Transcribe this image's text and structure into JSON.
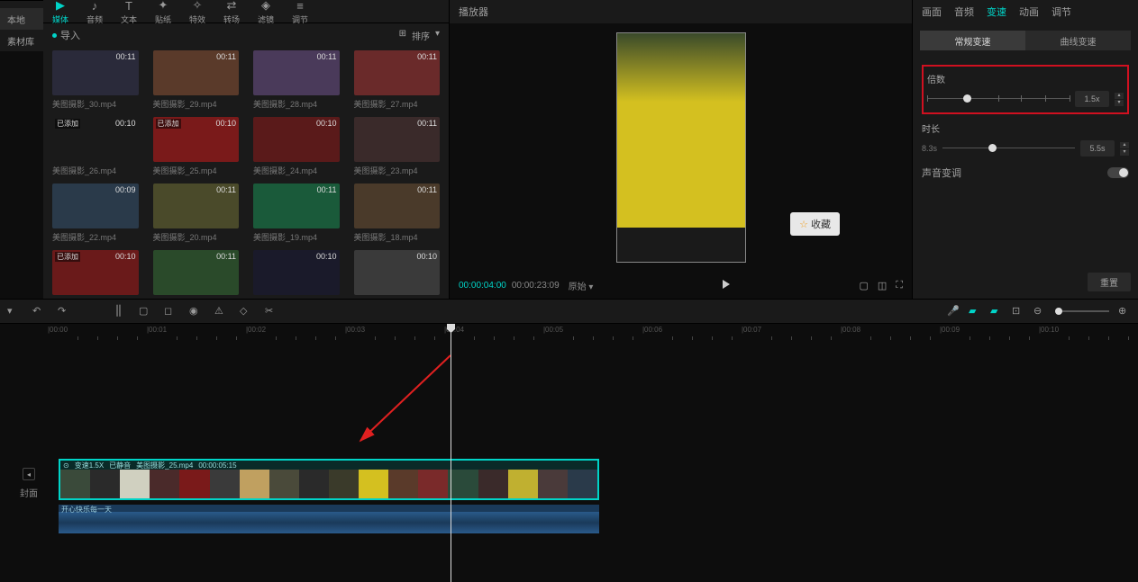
{
  "nav": {
    "tabs": [
      "媒体",
      "音频",
      "文本",
      "贴纸",
      "特效",
      "转场",
      "滤镜",
      "调节"
    ]
  },
  "sidebar": {
    "items": [
      "本地",
      "素材库"
    ]
  },
  "media": {
    "import": "导入",
    "sort": "排序",
    "items": [
      {
        "d": "00:11",
        "n": "美图摄影_30.mp4",
        "c": "#2a2a3a"
      },
      {
        "d": "00:11",
        "n": "美图摄影_29.mp4",
        "c": "#5a3a2a"
      },
      {
        "d": "00:11",
        "n": "美图摄影_28.mp4",
        "c": "#4a3a5a"
      },
      {
        "d": "00:11",
        "n": "美图摄影_27.mp4",
        "c": "#6a2a2a"
      },
      {
        "d": "00:10",
        "n": "美图摄影_26.mp4",
        "c": "#1a1a1a",
        "a": "已添加"
      },
      {
        "d": "00:10",
        "n": "美图摄影_25.mp4",
        "c": "#7a1a1a",
        "a": "已添加"
      },
      {
        "d": "00:10",
        "n": "美图摄影_24.mp4",
        "c": "#5a1a1a"
      },
      {
        "d": "00:11",
        "n": "美图摄影_23.mp4",
        "c": "#3a2a2a"
      },
      {
        "d": "00:09",
        "n": "美图摄影_22.mp4",
        "c": "#2a3a4a"
      },
      {
        "d": "00:11",
        "n": "美图摄影_20.mp4",
        "c": "#4a4a2a"
      },
      {
        "d": "00:11",
        "n": "美图摄影_19.mp4",
        "c": "#1a5a3a"
      },
      {
        "d": "00:11",
        "n": "美图摄影_18.mp4",
        "c": "#4a3a2a"
      },
      {
        "d": "00:10",
        "n": "",
        "c": "#6a1a1a",
        "a": "已添加"
      },
      {
        "d": "00:11",
        "n": "",
        "c": "#2a4a2a"
      },
      {
        "d": "00:10",
        "n": "",
        "c": "#1a1a2a"
      },
      {
        "d": "00:10",
        "n": "",
        "c": "#3a3a3a"
      }
    ]
  },
  "player": {
    "title": "播放器",
    "cur": "00:00:04:00",
    "tot": "00:00:23:09",
    "ratio": "原始",
    "fav": "收藏"
  },
  "props": {
    "tabs": [
      "画面",
      "音频",
      "变速",
      "动画",
      "调节"
    ],
    "subtabs": [
      "常规变速",
      "曲线变速"
    ],
    "speed_label": "倍数",
    "speed_val": "1.5x",
    "dur_label": "时长",
    "dur_from": "8.3s",
    "dur_to": "5.5s",
    "pitch": "声音变调",
    "reset": "重置"
  },
  "timeline": {
    "marks": [
      "00:00",
      "00:01",
      "00:02",
      "00:03",
      "00:04",
      "00:05",
      "00:06",
      "00:07",
      "00:08",
      "00:09",
      "00:10"
    ],
    "cover": "封面",
    "clip": {
      "speed": "变速1.5X",
      "mute": "已静音",
      "name": "美图摄影_25.mp4",
      "dur": "00:00:05:15"
    },
    "audio": "开心快乐每一天"
  }
}
